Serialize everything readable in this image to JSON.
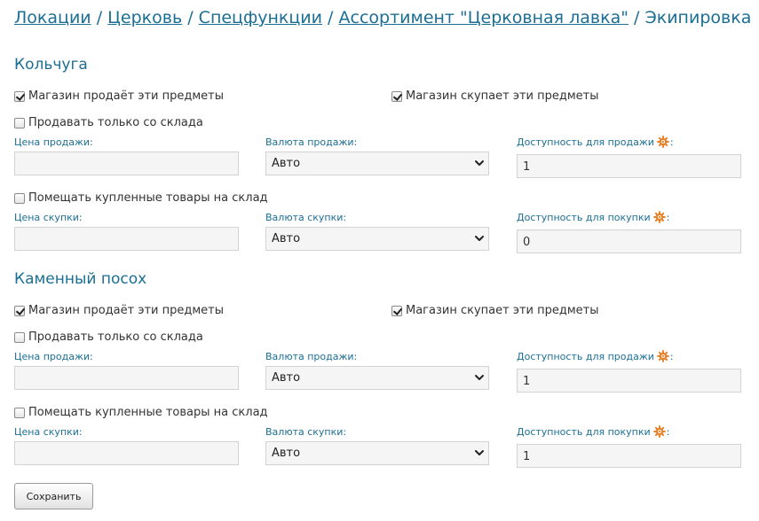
{
  "breadcrumb": {
    "items": [
      "Локации",
      "Церковь",
      "Спецфункции",
      "Ассортимент \"Церковная лавка\""
    ],
    "current": "Экипировка",
    "separator": "/"
  },
  "items": [
    {
      "title": "Кольчуга",
      "sell_items": {
        "label": "Магазин продаёт эти предметы",
        "checked": true
      },
      "buy_items": {
        "label": "Магазин скупает эти предметы",
        "checked": true
      },
      "sell_from_stock": {
        "label": "Продавать только со склада",
        "checked": false
      },
      "sell_price_label": "Цена продажи:",
      "sell_price_value": "",
      "sell_currency_label": "Валюта продажи:",
      "sell_currency_value": "Авто",
      "sell_availability_label": "Доступность для продажи",
      "sell_availability_value": "1",
      "put_to_stock": {
        "label": "Помещать купленные товары на склад",
        "checked": false
      },
      "buy_price_label": "Цена скупки:",
      "buy_price_value": "",
      "buy_currency_label": "Валюта скупки:",
      "buy_currency_value": "Авто",
      "buy_availability_label": "Доступность для покупки",
      "buy_availability_value": "0"
    },
    {
      "title": "Каменный посох",
      "sell_items": {
        "label": "Магазин продаёт эти предметы",
        "checked": true
      },
      "buy_items": {
        "label": "Магазин скупает эти предметы",
        "checked": true
      },
      "sell_from_stock": {
        "label": "Продавать только со склада",
        "checked": false
      },
      "sell_price_label": "Цена продажи:",
      "sell_price_value": "",
      "sell_currency_label": "Валюта продажи:",
      "sell_currency_value": "Авто",
      "sell_availability_label": "Доступность для продажи",
      "sell_availability_value": "1",
      "put_to_stock": {
        "label": "Помещать купленные товары на склад",
        "checked": false
      },
      "buy_price_label": "Цена скупки:",
      "buy_price_value": "",
      "buy_currency_label": "Валюта скупки:",
      "buy_currency_value": "Авто",
      "buy_availability_label": "Доступность для покупки",
      "buy_availability_value": "1"
    }
  ],
  "colon": ":",
  "save_label": "Сохранить",
  "colors": {
    "accent": "#1b6e94",
    "gear": "#e8822a"
  },
  "icons": {
    "gear": "gear-icon",
    "chevron": "chevron-down-icon"
  }
}
